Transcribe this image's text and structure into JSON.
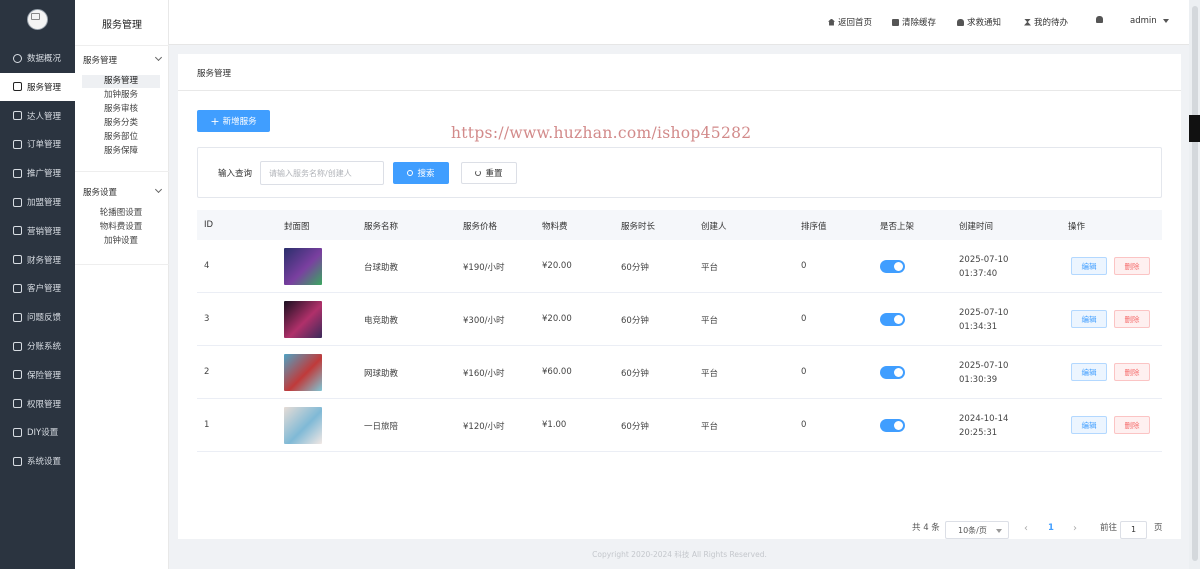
{
  "app": {
    "section_title": "服务管理"
  },
  "nav": {
    "items": [
      {
        "label": "数据概况",
        "icon": "dashboard-icon"
      },
      {
        "label": "服务管理",
        "icon": "services-icon",
        "active": true
      },
      {
        "label": "达人管理",
        "icon": "talent-icon"
      },
      {
        "label": "订单管理",
        "icon": "order-icon"
      },
      {
        "label": "推广管理",
        "icon": "promotion-icon"
      },
      {
        "label": "加盟管理",
        "icon": "franchise-icon"
      },
      {
        "label": "营销管理",
        "icon": "marketing-icon"
      },
      {
        "label": "财务管理",
        "icon": "finance-icon"
      },
      {
        "label": "客户管理",
        "icon": "customer-icon"
      },
      {
        "label": "问题反馈",
        "icon": "feedback-icon"
      },
      {
        "label": "分账系统",
        "icon": "split-icon"
      },
      {
        "label": "保险管理",
        "icon": "insurance-icon"
      },
      {
        "label": "权限管理",
        "icon": "permission-icon"
      },
      {
        "label": "DIY设置",
        "icon": "diy-icon"
      },
      {
        "label": "系统设置",
        "icon": "settings-icon"
      }
    ]
  },
  "subnav": {
    "title": "服务管理",
    "groups": [
      {
        "label": "服务管理",
        "items": [
          "服务管理",
          "加钟服务",
          "服务审核",
          "服务分类",
          "服务部位",
          "服务保障"
        ]
      },
      {
        "label": "服务设置",
        "items": [
          "轮播图设置",
          "物料费设置",
          "加钟设置"
        ]
      }
    ]
  },
  "header": {
    "links": [
      {
        "label": "返回首页",
        "icon": "home-icon"
      },
      {
        "label": "清除缓存",
        "icon": "broom-icon"
      },
      {
        "label": "求救通知",
        "icon": "alarm-icon"
      },
      {
        "label": "我的待办",
        "icon": "hourglass-icon"
      }
    ],
    "user": "admin"
  },
  "page": {
    "breadcrumb": "服务管理",
    "add_button": "新增服务",
    "watermark": "https://www.huzhan.com/ishop45282",
    "search": {
      "label": "输入查询",
      "placeholder": "请输入服务名称/创建人",
      "search_button": "搜索",
      "reset_button": "重置"
    }
  },
  "table": {
    "headers": [
      "ID",
      "封面图",
      "服务名称",
      "服务价格",
      "物料费",
      "服务时长",
      "创建人",
      "排序值",
      "是否上架",
      "创建时间",
      "操作"
    ],
    "rows": [
      {
        "id": "4",
        "name": "台球助教",
        "price": "¥190/小时",
        "material": "¥20.00",
        "duration": "60分钟",
        "creator": "平台",
        "sort": "0",
        "listed": true,
        "date": "2025-07-10",
        "time": "01:37:40",
        "cover_colors": [
          "#2a2f6b",
          "#7a3fa0",
          "#3aa860"
        ]
      },
      {
        "id": "3",
        "name": "电竞助教",
        "price": "¥300/小时",
        "material": "¥20.00",
        "duration": "60分钟",
        "creator": "平台",
        "sort": "0",
        "listed": true,
        "date": "2025-07-10",
        "time": "01:34:31",
        "cover_colors": [
          "#1a1020",
          "#b0306a",
          "#3a2a5a"
        ]
      },
      {
        "id": "2",
        "name": "网球助教",
        "price": "¥160/小时",
        "material": "¥60.00",
        "duration": "60分钟",
        "creator": "平台",
        "sort": "0",
        "listed": true,
        "date": "2025-07-10",
        "time": "01:30:39",
        "cover_colors": [
          "#4fa3c4",
          "#c03a3a",
          "#7fc7d6"
        ]
      },
      {
        "id": "1",
        "name": "一日旅陪",
        "price": "¥120/小时",
        "material": "¥1.00",
        "duration": "60分钟",
        "creator": "平台",
        "sort": "0",
        "listed": true,
        "date": "2024-10-14",
        "time": "20:25:31",
        "cover_colors": [
          "#e6dcd6",
          "#7fb9d6",
          "#f2e8e4"
        ]
      }
    ],
    "edit_label": "编辑",
    "delete_label": "删除"
  },
  "pagination": {
    "total": "共 4 条",
    "page_size": "10条/页",
    "current_page": "1",
    "goto_label": "前往",
    "goto_value": "1",
    "page_suffix": "页"
  },
  "footer": "Copyright 2020-2024 科技 All Rights Reserved.",
  "colors": {
    "primary": "#409eff",
    "danger": "#f56c6c",
    "nav_bg": "#2b3440"
  }
}
